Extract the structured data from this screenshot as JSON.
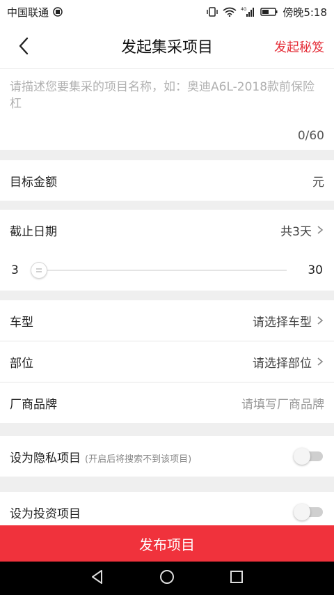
{
  "status_bar": {
    "carrier": "中国联通",
    "network_label": "4G",
    "time": "傍晚5:18",
    "icons": [
      "carrier-badge-icon",
      "vibrate-icon",
      "wifi-icon",
      "signal-icon",
      "battery-icon"
    ]
  },
  "header": {
    "title": "发起集采项目",
    "action": "发起秘笈",
    "back_icon": "back-arrow-icon",
    "accent_color": "#e5303a"
  },
  "description": {
    "placeholder": "请描述您要集采的项目名称，如：奥迪A6L-2018款前保险杠",
    "count": "0/60"
  },
  "target_amount": {
    "label": "目标金额",
    "unit": "元"
  },
  "deadline": {
    "label": "截止日期",
    "value": "共3天",
    "slider": {
      "min": "3",
      "max": "30",
      "current": 3
    }
  },
  "vehicle": {
    "label": "车型",
    "value": "请选择车型"
  },
  "part": {
    "label": "部位",
    "value": "请选择部位"
  },
  "brand": {
    "label": "厂商品牌",
    "placeholder": "请填写厂商品牌"
  },
  "privacy": {
    "label": "设为隐私项目",
    "note": "(开启后将搜索不到该项目)",
    "enabled": false
  },
  "investment": {
    "label": "设为投资项目",
    "enabled": false
  },
  "publish": {
    "label": "发布项目",
    "color": "#f0323c"
  },
  "nav": {
    "icons": [
      "nav-back-icon",
      "nav-home-icon",
      "nav-recent-icon"
    ]
  }
}
